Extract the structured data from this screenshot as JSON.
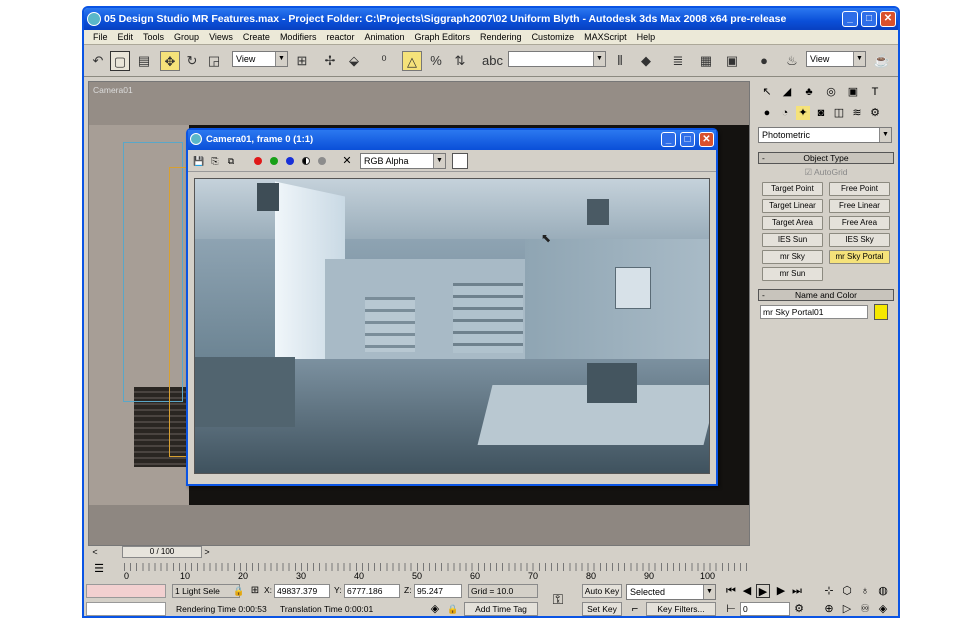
{
  "window": {
    "title": "05 Design Studio MR Features.max   - Project Folder: C:\\Projects\\Siggraph2007\\02 Uniform Blyth    - Autodesk 3ds Max 2008 x64 pre-release"
  },
  "menu": [
    "File",
    "Edit",
    "Tools",
    "Group",
    "Views",
    "Create",
    "Modifiers",
    "reactor",
    "Animation",
    "Graph Editors",
    "Rendering",
    "Customize",
    "MAXScript",
    "Help"
  ],
  "toolbar": {
    "view_dropdown": "View",
    "view_dropdown2": "View"
  },
  "viewport": {
    "label": "Camera01"
  },
  "render_window": {
    "title": "Camera01, frame 0 (1:1)",
    "channel_dropdown": "RGB Alpha",
    "channel_colors": [
      "#e01818",
      "#18a018",
      "#1830d8"
    ]
  },
  "command_panel": {
    "category_dropdown": "Photometric",
    "object_type": {
      "header": "Object Type",
      "autogrid_label": "AutoGrid",
      "buttons": [
        "Target Point",
        "Free Point",
        "Target Linear",
        "Free Linear",
        "Target Area",
        "Free Area",
        "IES Sun",
        "IES Sky",
        "mr Sky",
        "mr Sky Portal",
        "mr Sun"
      ]
    },
    "name_and_color": {
      "header": "Name and Color",
      "name_value": "mr Sky Portal01",
      "swatch_color": "#f5e800"
    }
  },
  "timeline": {
    "slider_label": "0 / 100",
    "ticks": [
      "0",
      "10",
      "20",
      "30",
      "40",
      "50",
      "60",
      "70",
      "80",
      "90",
      "100"
    ]
  },
  "status": {
    "selection": "1 Light Sele",
    "x_label": "X:",
    "x_value": "49837.379",
    "y_label": "Y:",
    "y_value": "6777.186",
    "z_label": "Z:",
    "z_value": "95.247",
    "grid": "Grid = 10.0",
    "rendering_time": "Rendering Time  0:00:53",
    "translation_time": "Translation Time  0:00:01",
    "add_time_tag": "Add Time Tag",
    "auto_key": "Auto Key",
    "selected_dropdown": "Selected",
    "set_key": "Set Key",
    "key_filters": "Key Filters...",
    "frame_value": "0"
  }
}
